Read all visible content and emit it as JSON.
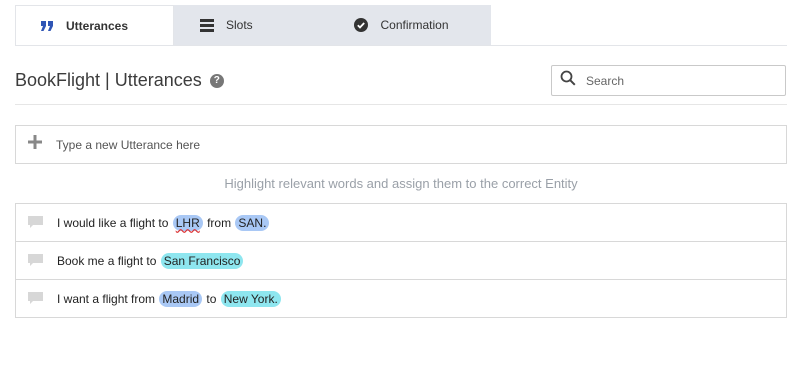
{
  "tabs": [
    {
      "label": "Utterances",
      "icon": "quote-icon",
      "active": true
    },
    {
      "label": "Slots",
      "icon": "list-icon",
      "active": false
    },
    {
      "label": "Confirmation",
      "icon": "check-circle-icon",
      "active": false
    }
  ],
  "header": {
    "title": "BookFlight | Utterances",
    "help_icon": "question-circle-icon",
    "search_placeholder": "Search"
  },
  "new_utterance": {
    "placeholder": "Type a new Utterance here",
    "icon": "plus-icon"
  },
  "hint": "Highlight relevant words and assign them to the correct Entity",
  "utterances": [
    {
      "segments": [
        {
          "text": "I would like a flight to "
        },
        {
          "text": "LHR",
          "entity": "code"
        },
        {
          "text": " from "
        },
        {
          "text": "SAN.",
          "entity": "code"
        }
      ]
    },
    {
      "segments": [
        {
          "text": "Book me a flight to "
        },
        {
          "text": "San Francisco",
          "entity": "city"
        }
      ]
    },
    {
      "segments": [
        {
          "text": "I want a flight from "
        },
        {
          "text": "Madrid",
          "entity": "code"
        },
        {
          "text": " to "
        },
        {
          "text": "New York.",
          "entity": "city"
        }
      ]
    }
  ],
  "colors": {
    "entity_code": "#a9c8f5",
    "entity_city": "#8ee6ef",
    "tab_inactive": "#e3e6ec"
  }
}
